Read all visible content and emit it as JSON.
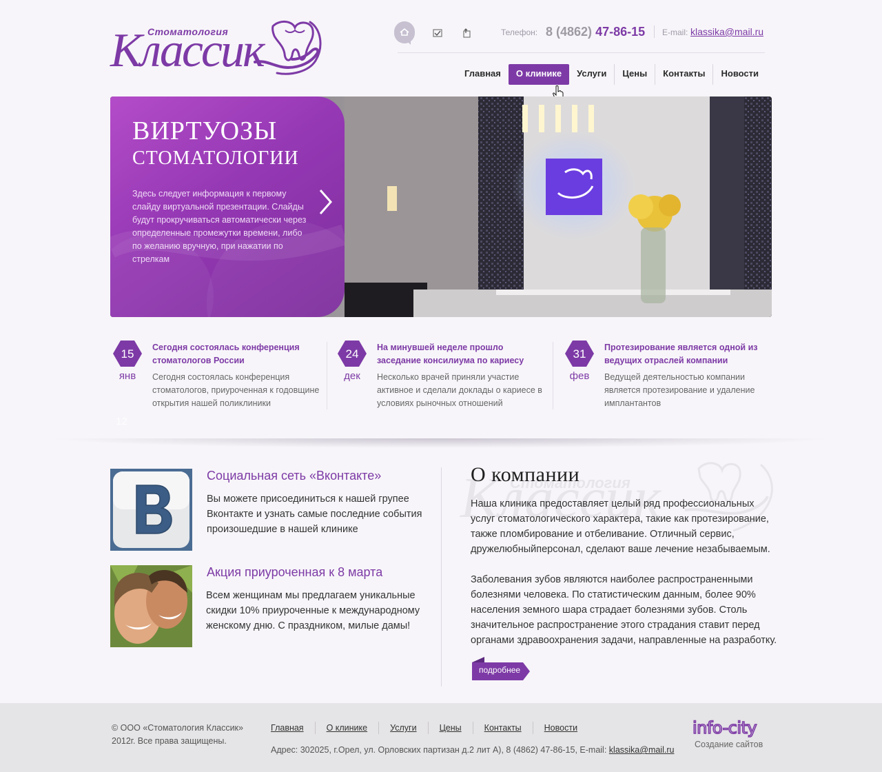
{
  "header": {
    "logo_subtitle": "Стоматология",
    "logo_title": "Классик",
    "phone_label": "Телефон:",
    "phone_prefix": "8 (4862)",
    "phone_number": "47-86-15",
    "email_label": "E-mail:",
    "email_value": "klassika@mail.ru",
    "icons": [
      "home-icon",
      "mail-icon",
      "map-icon"
    ]
  },
  "nav": {
    "items": [
      {
        "label": "Главная",
        "active": false
      },
      {
        "label": "О клинике",
        "active": true
      },
      {
        "label": "Услуги",
        "active": false
      },
      {
        "label": "Цены",
        "active": false
      },
      {
        "label": "Контакты",
        "active": false
      },
      {
        "label": "Новости",
        "active": false
      }
    ]
  },
  "slider": {
    "title_line1": "ВИРТУОЗЫ",
    "title_line2": "СТОМАТОЛОГИИ",
    "text": "Здесь следует информация к первому слайду виртуальной презентации. Слайды будут прокручиваться автоматически через определенные промежутки времени, либо по желанию вручную, при нажатии по стрелкам"
  },
  "news": [
    {
      "day": "15",
      "month": "янв",
      "title": "Сегодня состоялась конференция стоматологов России",
      "body": "Сегодня состоялась конференция стоматологов, приуроченная к годовщине открытия нашей поликлиники"
    },
    {
      "day": "24",
      "month": "дек",
      "title": "На минувшей неделе прошло заседание консилиума по кариесу",
      "body": "Несколько врачей приняли участие активное и сделали доклады о кариесе в условиях рыночных отношений"
    },
    {
      "day": "31",
      "month": "фев",
      "title": "Протезирование является одной из ведущих отраслей компании",
      "body": "Ведущей деятельностью компании является протезирование и удаление имплантантов"
    }
  ],
  "faint_number": "12",
  "promos": [
    {
      "title": "Социальная сеть «Вконтакте»",
      "text": "Вы можете присоединиться к нашей групее Вконтакте и узнать самые последние события произошедшие в нашей клинике"
    },
    {
      "title": "Акция приуроченная к 8 марта",
      "text": "Всем женщинам мы предлагаем уникальные скидки 10% приуроченные к международному женскому дню. С праздником, милые дамы!"
    }
  ],
  "about": {
    "title": "О компании",
    "p1": "Наша клиника предоставляет целый ряд профессиональных услуг стоматологического характера, такие как протезирование, также пломбирование и отбеливание. Отличный сервис, дружелюбныйперсонал, сделают ваше лечение незабываемым.",
    "p2": "Заболевания зубов являются наиболее распространенными болезнями человека. По статистическим данным, более 90% населения земного шара страдает болезнями зубов. Столь значительное распространение этого страдания ставит перед органами здравоохранения задачи, направленные на разработку.",
    "more_label": "подробнее",
    "watermark_subtitle": "Стоматология",
    "watermark_title": "Классик"
  },
  "footer": {
    "copyright_line1": "© ООО «Стоматология Классик»",
    "copyright_line2": "2012г. Все права защищены.",
    "nav": [
      "Главная",
      "О клинике",
      "Услуги",
      "Цены",
      "Контакты",
      "Новости"
    ],
    "address_text": "Адрес: 302025, г.Орел, ул. Орловских партизан д.2 лит А), 8 (4862) 47-86-15, E-mail:",
    "address_email": "klassika@mail.ru",
    "developer_logo": "info-city",
    "developer_caption": "Создание сайтов"
  },
  "colors": {
    "brand_purple": "#7d3aa6",
    "background": "#f7f5f9",
    "footer_bg": "#e5e4e6"
  }
}
